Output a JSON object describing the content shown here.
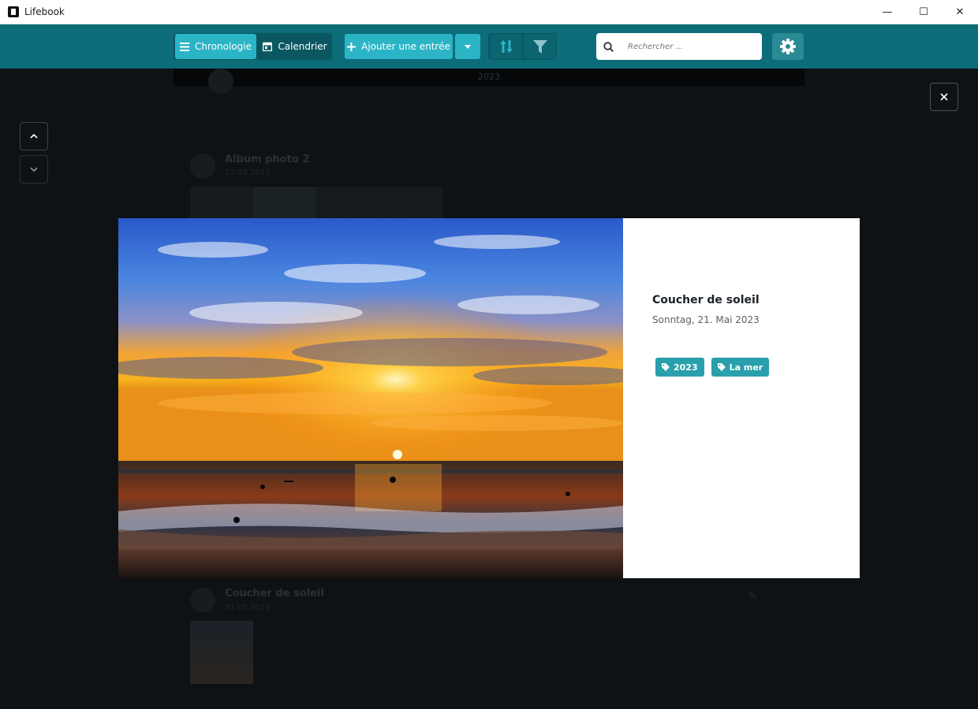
{
  "window": {
    "title": "Lifebook",
    "controls": {
      "minimize": "—",
      "maximize": "☐",
      "close": "✕"
    }
  },
  "toolbar": {
    "view_timeline_label": "Chronologie",
    "view_calendar_label": "Calendrier",
    "add_entry_label": "Ajouter une entrée",
    "search_placeholder": "Rechercher ...",
    "colors": {
      "bar": "#0c6d79",
      "accent": "#2bb4c6"
    }
  },
  "background": {
    "year_label": "2023",
    "entries": [
      {
        "title": "Album photo 2",
        "date": "22.03.2023"
      },
      {
        "title": "Coucher de soleil",
        "date": "21.05.2023"
      }
    ]
  },
  "lightbox": {
    "title": "Coucher de soleil",
    "date": "Sonntag, 21. Mai 2023",
    "tags": [
      {
        "label": "2023"
      },
      {
        "label": "La mer"
      }
    ],
    "close_symbol": "✕",
    "nav_up_symbol": "⌃",
    "nav_down_symbol": "⌄"
  }
}
